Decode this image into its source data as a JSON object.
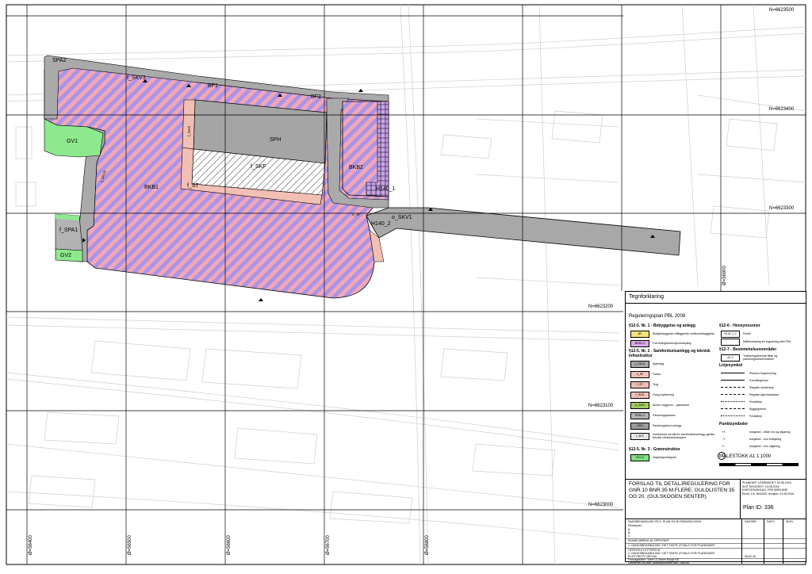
{
  "map": {
    "north_coords": [
      "N=6623500",
      "N=6623400",
      "N=6623300",
      "N=6623200",
      "N=6623100",
      "N=6623000"
    ],
    "east_coords": [
      "Ø=56400",
      "Ø=56500",
      "Ø=56600",
      "Ø=56700",
      "Ø=56800"
    ],
    "side_coord": "Ø=56900",
    "zones": {
      "sp_a2": "SPA2",
      "f_skv3": "f_SKV3",
      "bf1": "BF1",
      "bf2": "BF2",
      "f_sgs": "f_SGS",
      "sph": "SPH",
      "f_skf": "f_SKF",
      "bkb1": "BKB1",
      "bkb2": "BKB2",
      "f_st": "f_ST",
      "gv1": "GV1",
      "f_skv2": "f_SKV2",
      "f_spa1": "f_SPA1",
      "gv2": "GV2",
      "h140_1": "H140_1",
      "h140_2": "H140_2",
      "o_skv1": "o_SKV1",
      "o_sf": "o_SF"
    }
  },
  "legend": {
    "title": "Tegnforklaring",
    "subtitle": "Reguleringsplan PBL 2008",
    "sec1": "§12-5. Nr. 1 - Bebyggelse og anlegg",
    "sec2": "§12-5. Nr. 2 - Samferdselsanlegg og teknisk infrastruktur",
    "sec3": "§12-5. Nr. 3 - Grønnstruktur",
    "sec4": "§12-6 - Hensynssoner",
    "sec5": "§12-7 - Bestemmelsesområder",
    "lines_heading": "Linjesymbol",
    "points_heading": "Punktsymboler",
    "items_left": [
      {
        "code": "BF",
        "label": "Boligbebyggelse-frittliggende småhusbebyggelse",
        "color": "#f5e27a"
      },
      {
        "code": "BKB1-2",
        "label": "Forretning/kontor/tjenesteyting",
        "color": "#d8a8e6"
      },
      {
        "code": "o_SKV1",
        "label": "Kjøreveg",
        "color": "#a9a9a9"
      },
      {
        "code": "o_SF",
        "label": "Fortau",
        "color": "#f2c1b8"
      },
      {
        "code": "f_ST",
        "label": "Torg",
        "color": "#f0bcb0"
      },
      {
        "code": "f_SGS",
        "label": "Gang-/sykkelveg",
        "color": "#f2c1b8"
      },
      {
        "code": "o_SVG",
        "label": "Annen veggrunn - grøntareal",
        "color": "#9ecb5f"
      },
      {
        "code": "SPA1-2",
        "label": "Parkeringsplasser",
        "color": "#b3b3b3"
      },
      {
        "code": "SPH",
        "label": "Parkeringshus/-anlegg",
        "color": "#9a9a9a"
      },
      {
        "code": "f_SKF",
        "label": "Kombinerte formål for samferdselsanlegg og/eller teknisk infrastrukturtraseer",
        "color": "#e6e6e6"
      },
      {
        "code": "GV1-2",
        "label": "Vegetasjonsskjerm",
        "color": "#7fe07f"
      }
    ],
    "items_right": [
      {
        "code": "H140_1-2",
        "label": "Frisikt"
      },
      {
        "code": "",
        "label": "Måleforklaring for regulering etter PBL"
      },
      {
        "code": "#1-2",
        "label": "Trafikkregulerende tiltak og parkeringsbestemmelser"
      }
    ],
    "lines": [
      "Planens begrensning",
      "Formålsgrense",
      "Regulert senterlinje",
      "Regulert kjørebanekant",
      "Frisiktlinje",
      "Byggegrense",
      "Frisiktlinje"
    ],
    "points": [
      "Avkjørsel - både inn og utkjøring",
      "Avkjørsel - kun innkjøring",
      "Avkjørsel - kun utkjøring"
    ],
    "scale": "MÅLESTOKK A1 1:1000"
  },
  "title_block": {
    "title": "FORSLAG TIL DETALJREGULERING FOR GNR.10 BNR.35 M.FLERE, GULDLISTEN 35 OG 20, (GULSKOGEN SENTER)",
    "plan_id": "Plan ID: 336",
    "side_info": [
      "PLANKART UTARBEIDET: 04.06.2016",
      "SIST REVIDERT: 15.08.2016",
      "KARTGRUNNLAG: FKB SØRLAND",
      "Ekvid: 1m, NN2000, revisjon: 01.06.2016"
    ],
    "rev_header": "SAKSBEHANDLING IFLG. PLAN OG BYGNINGSLOVEN",
    "rev_columns": [
      "SAKSNR",
      "DATO",
      "SIGN"
    ],
    "revisions": [
      "Revisjoner",
      "A",
      "B",
      "C"
    ],
    "rows": [
      "KUNNGJØRING AV OPPSTART",
      "1. GANGSBEHANDLING I DET FASTE UTVALG FOR PLANSAKER",
      "OFFENTLIG ETTERSYN",
      "2. GANGSBEHANDLING I DET FASTE UTVALG FOR PLANSAKER",
      "BYSTYRETS VEDTAK"
    ],
    "footer": [
      "Forslagsstiller: Steen & Strøm Norge AS",
      "Utarbeidet av plan: Arkitektkontoret Nils Tveit AS"
    ],
    "date": "08.02.16"
  }
}
